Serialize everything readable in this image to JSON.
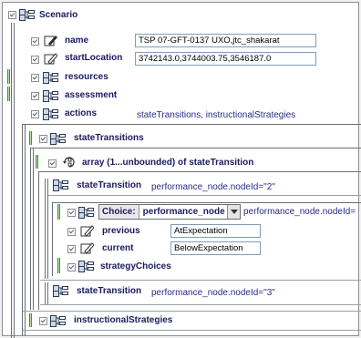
{
  "tree": {
    "root": {
      "label": "Scenario"
    },
    "name": {
      "label": "name",
      "value": "TSP 07-GFT-0137 UXO,jtc_shakarat"
    },
    "startLocation": {
      "label": "startLocation",
      "value": "3742143.0,3744003.75,3546187.0"
    },
    "resources": {
      "label": "resources"
    },
    "assessment": {
      "label": "assessment"
    },
    "actions": {
      "label": "actions",
      "desc": "stateTransitions, instructionalStrategies"
    },
    "stateTransitions": {
      "label": "stateTransitions"
    },
    "array": {
      "label": "array (1...unbounded) of stateTransition"
    },
    "st1": {
      "label": "stateTransition",
      "desc": "performance_node.nodeId=\"2\""
    },
    "choice": {
      "prefix": "Choice:",
      "selected": "performance_node",
      "desc": "performance_node.nodeId="
    },
    "previous": {
      "label": "previous",
      "value": "AtExpectation"
    },
    "current": {
      "label": "current",
      "value": "BelowExpectation"
    },
    "strategyChoices": {
      "label": "strategyChoices"
    },
    "st2": {
      "label": "stateTransition",
      "desc": "performance_node.nodeId=\"3\""
    },
    "instructionalStrategies": {
      "label": "instructionalStrategies"
    }
  }
}
